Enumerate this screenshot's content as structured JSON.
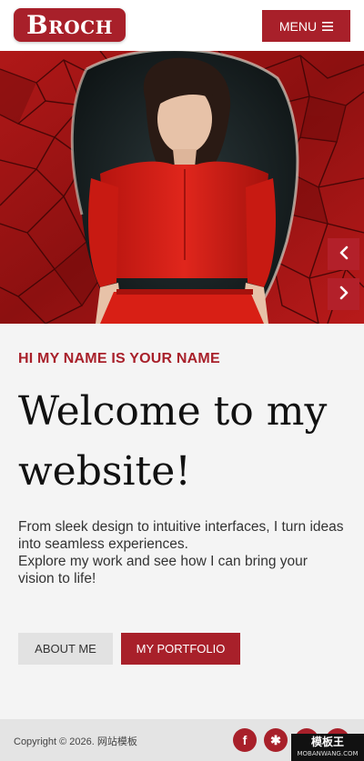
{
  "header": {
    "logo": {
      "initial": "B",
      "rest": "ROCH"
    },
    "menu_label": "MENU",
    "menu_icon": "hamburger-icon"
  },
  "hero": {
    "image": "woman-in-red-dress-against-broken-red-wall",
    "prev_icon": "chevron-left-icon",
    "next_icon": "chevron-right-icon"
  },
  "intro": {
    "eyebrow": "HI MY NAME IS YOUR NAME",
    "title": "Welcome to my website!",
    "description_1": "From sleek design to intuitive interfaces, I turn ideas into seamless experiences.",
    "description_2": "Explore my work and see how I can bring your vision to life!"
  },
  "buttons": {
    "about": "ABOUT ME",
    "portfolio": "MY PORTFOLIO"
  },
  "footer": {
    "copyright": "Copyright © 2026. 网站模板",
    "social": [
      {
        "icon": "facebook-icon",
        "glyph": "f"
      },
      {
        "icon": "yelp-icon",
        "glyph": "✱"
      },
      {
        "icon": "social-icon-3",
        "glyph": ""
      },
      {
        "icon": "social-icon-4",
        "glyph": ""
      }
    ]
  },
  "watermark": {
    "line1": "模板王",
    "line2": "MOBANWANG.COM"
  },
  "colors": {
    "accent": "#a8202a",
    "background": "#f4f4f4",
    "footer": "#e4e4e4"
  }
}
